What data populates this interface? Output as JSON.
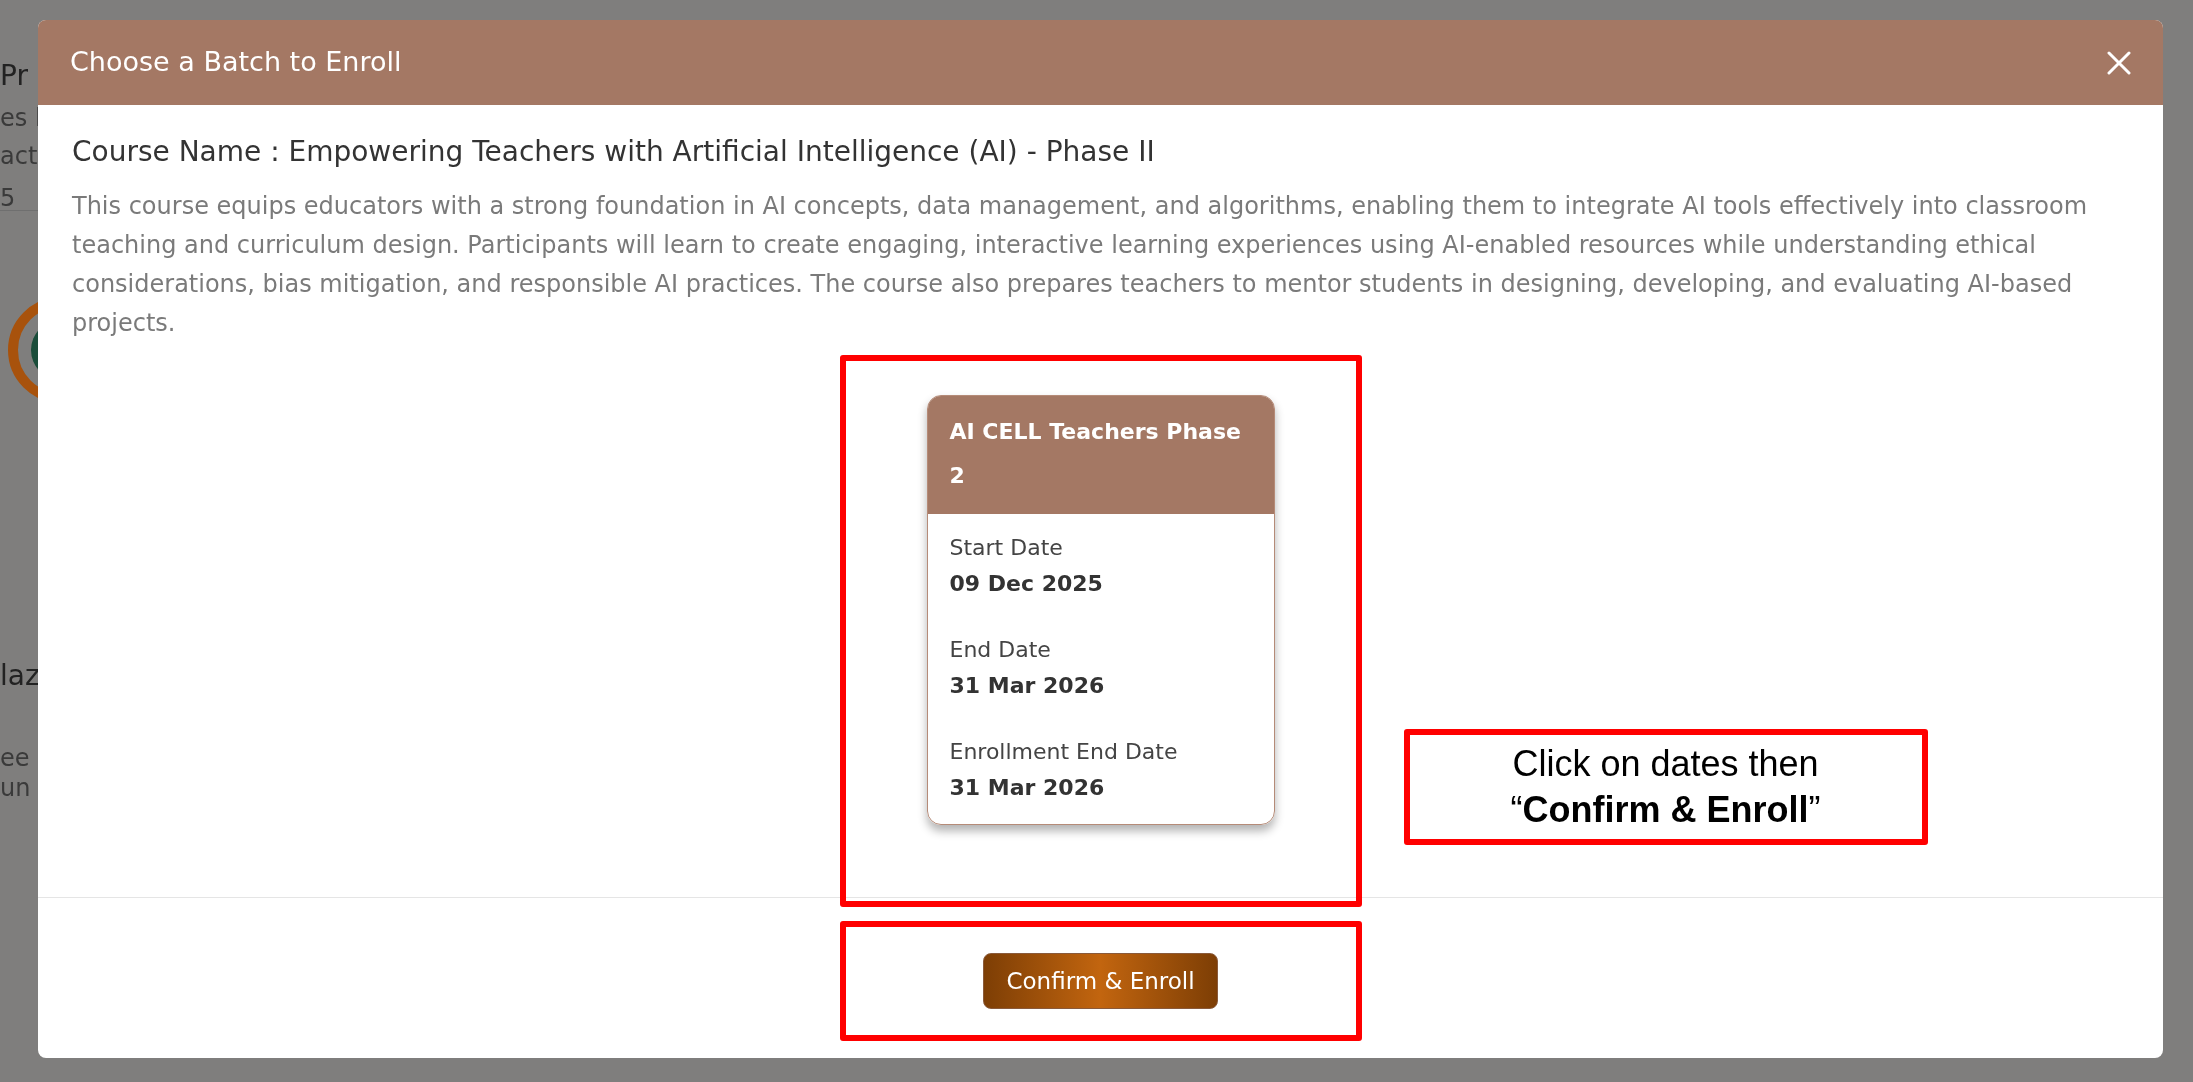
{
  "background_fragments": [
    {
      "text": "Pr",
      "kind": "heading"
    },
    {
      "text": "es l",
      "kind": "text"
    },
    {
      "text": "act",
      "kind": "text"
    },
    {
      "text": "5",
      "kind": "meta"
    },
    {
      "text": "laz",
      "kind": "heading"
    },
    {
      "text": "ee",
      "kind": "text"
    },
    {
      "text": "un",
      "kind": "text"
    }
  ],
  "modal": {
    "title": "Choose a Batch to Enroll",
    "course_name": "Course Name : Empowering Teachers with Artificial Intelligence (AI) - Phase II",
    "description": "This course equips educators with a strong foundation in AI concepts, data management, and algorithms, enabling them to integrate AI tools effectively into classroom teaching and curriculum design. Participants will learn to create engaging, interactive learning experiences using AI-enabled resources while understanding ethical considerations, bias mitigation, and responsible AI practices. The course also prepares teachers to mentor students in designing, developing, and evaluating AI-based projects.",
    "batches": [
      {
        "name": "AI CELL Teachers Phase 2",
        "highlighted": true,
        "fields": [
          {
            "label": "Start Date",
            "value": "09 Dec 2025"
          },
          {
            "label": "End Date",
            "value": "31 Mar 2026"
          },
          {
            "label": "Enrollment End Date",
            "value": "31 Mar 2026"
          }
        ]
      }
    ],
    "confirm_button": "Confirm & Enroll",
    "confirm_highlighted": true
  },
  "annotation": {
    "callout": "Click on dates then “**Confirm & Enroll**”"
  }
}
